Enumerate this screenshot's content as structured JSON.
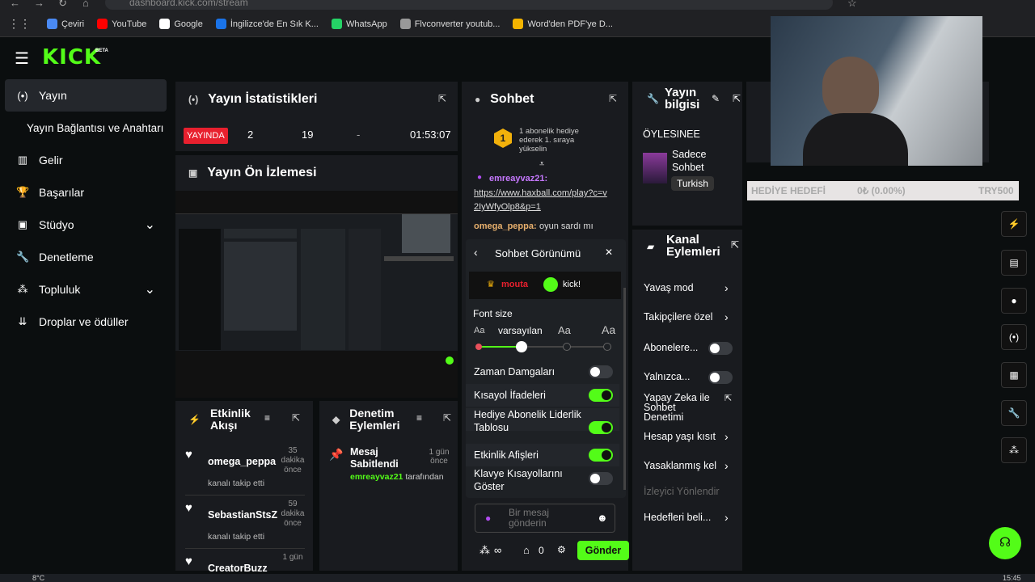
{
  "browser": {
    "url": "dashboard.kick.com/stream"
  },
  "bookmarks": [
    {
      "label": "Çeviri",
      "icon": "translate-icon",
      "color": "#4a8af4"
    },
    {
      "label": "YouTube",
      "icon": "youtube-icon",
      "color": "#ff0000"
    },
    {
      "label": "Google",
      "icon": "google-icon",
      "color": "#ffffff"
    },
    {
      "label": "İngilizce'de En Sık K...",
      "icon": "site-icon",
      "color": "#1a73e8"
    },
    {
      "label": "WhatsApp",
      "icon": "whatsapp-icon",
      "color": "#25d366"
    },
    {
      "label": "Flvconverter youtub...",
      "icon": "site-icon",
      "color": "#999999"
    },
    {
      "label": "Word'den PDF'ye D...",
      "icon": "site-icon",
      "color": "#f4b400"
    }
  ],
  "brand": {
    "logo": "KICK",
    "badge": "BETA",
    "accent": "#53fc18"
  },
  "sidebar": {
    "items": [
      {
        "label": "Yayın",
        "icon": "broadcast-icon",
        "active": true
      },
      {
        "label": "Yayın Bağlantısı ve Anahtarı",
        "icon": ""
      },
      {
        "label": "Gelir",
        "icon": "chart-icon"
      },
      {
        "label": "Başarılar",
        "icon": "trophy-icon"
      },
      {
        "label": "Stüdyo",
        "icon": "studio-icon",
        "chevron": true
      },
      {
        "label": "Denetleme",
        "icon": "wrench-icon"
      },
      {
        "label": "Topluluk",
        "icon": "community-icon",
        "chevron": true
      },
      {
        "label": "Droplar ve ödüller",
        "icon": "drops-icon"
      }
    ]
  },
  "stats": {
    "title": "Yayın İstatistikleri",
    "live_label": "YAYINDA",
    "viewers": "2",
    "followers": "19",
    "dash": "-",
    "duration": "01:53:07"
  },
  "preview": {
    "title": "Yayın Ön İzlemesi"
  },
  "activity": {
    "title": "Etkinlik Akışı",
    "events": [
      {
        "user": "omega_peppa",
        "action": "kanalı takip etti",
        "ago_num": "35",
        "ago_unit": "dakika",
        "ago_suffix": "önce"
      },
      {
        "user": "SebastianStsZ",
        "action": "kanalı takip etti",
        "ago_num": "59",
        "ago_unit": "dakika",
        "ago_suffix": "önce"
      },
      {
        "user": "CreatorBuzz",
        "action": "",
        "ago_num": "1 gün",
        "ago_unit": "",
        "ago_suffix": ""
      }
    ]
  },
  "moderation": {
    "title": "Denetim Eylemleri",
    "action_title": "Mesaj Sabitlendi",
    "ago_num": "1 gün",
    "ago_suffix": "önce",
    "by_user": "emreayvaz21",
    "by_text": "tarafından"
  },
  "chat": {
    "title": "Sohbet",
    "gift_rank": "1",
    "gift_text": "1 abonelik hediye ederek 1. sıraya yükselin",
    "msg1_user": "emreayvaz21:",
    "msg1_link": "https://www.haxball.com/play?c=v2IyWfyOlp8&p=1",
    "msg2_user": "omega_peppa:",
    "msg2_text": "oyun sardı mı",
    "input_placeholder": "Bir mesaj gönderin",
    "send_label": "Gönder",
    "points": "∞",
    "box_count": "0"
  },
  "chatview": {
    "title": "Sohbet Görünümü",
    "preview_user": "mouta",
    "preview_text": "kick!",
    "font_label": "Font size",
    "font_sizes": [
      "Aa",
      "varsayılan",
      "Aa",
      "Aa"
    ],
    "font_level": 0.33,
    "options": [
      {
        "label": "Zaman Damgaları",
        "on": false
      },
      {
        "label": "Kısayol İfadeleri",
        "on": true
      },
      {
        "label": "Hediye Abonelik Liderlik Tablosu",
        "on": true
      },
      {
        "label": "Etkinlik Afişleri",
        "on": true
      },
      {
        "label": "Klavye Kısayollarını Göster",
        "on": false
      }
    ]
  },
  "streaminfo": {
    "title": "Yayın bilgisi",
    "stream_title": "ÖYLESINEE",
    "category": "Sadece Sohbet",
    "language": "Turkish"
  },
  "channel": {
    "title": "Kanal Eylemleri",
    "actions": [
      {
        "label": "Yavaş mod",
        "kind": "chevron"
      },
      {
        "label": "Takipçilere özel",
        "kind": "chevron"
      },
      {
        "label": "Abonelere...",
        "kind": "toggle"
      },
      {
        "label": "Yalnızca...",
        "kind": "toggle"
      },
      {
        "label": "Yapay Zeka ile Sohbet Denetimi",
        "kind": "external"
      },
      {
        "label": "Hesap yaşı kısıt",
        "kind": "chevron"
      },
      {
        "label": "Yasaklanmış kel",
        "kind": "chevron"
      },
      {
        "label": "İzleyici Yönlendir",
        "kind": "disabled"
      },
      {
        "label": "Hedefleri beli...",
        "kind": "chevron"
      }
    ]
  },
  "goal": {
    "label": "HEDİYE HEDEFİ",
    "amount": "0₺ (0.00%)",
    "target": "TRY500",
    "progress": 0
  },
  "taskbar": {
    "temp": "8°C",
    "time": "15:45"
  }
}
